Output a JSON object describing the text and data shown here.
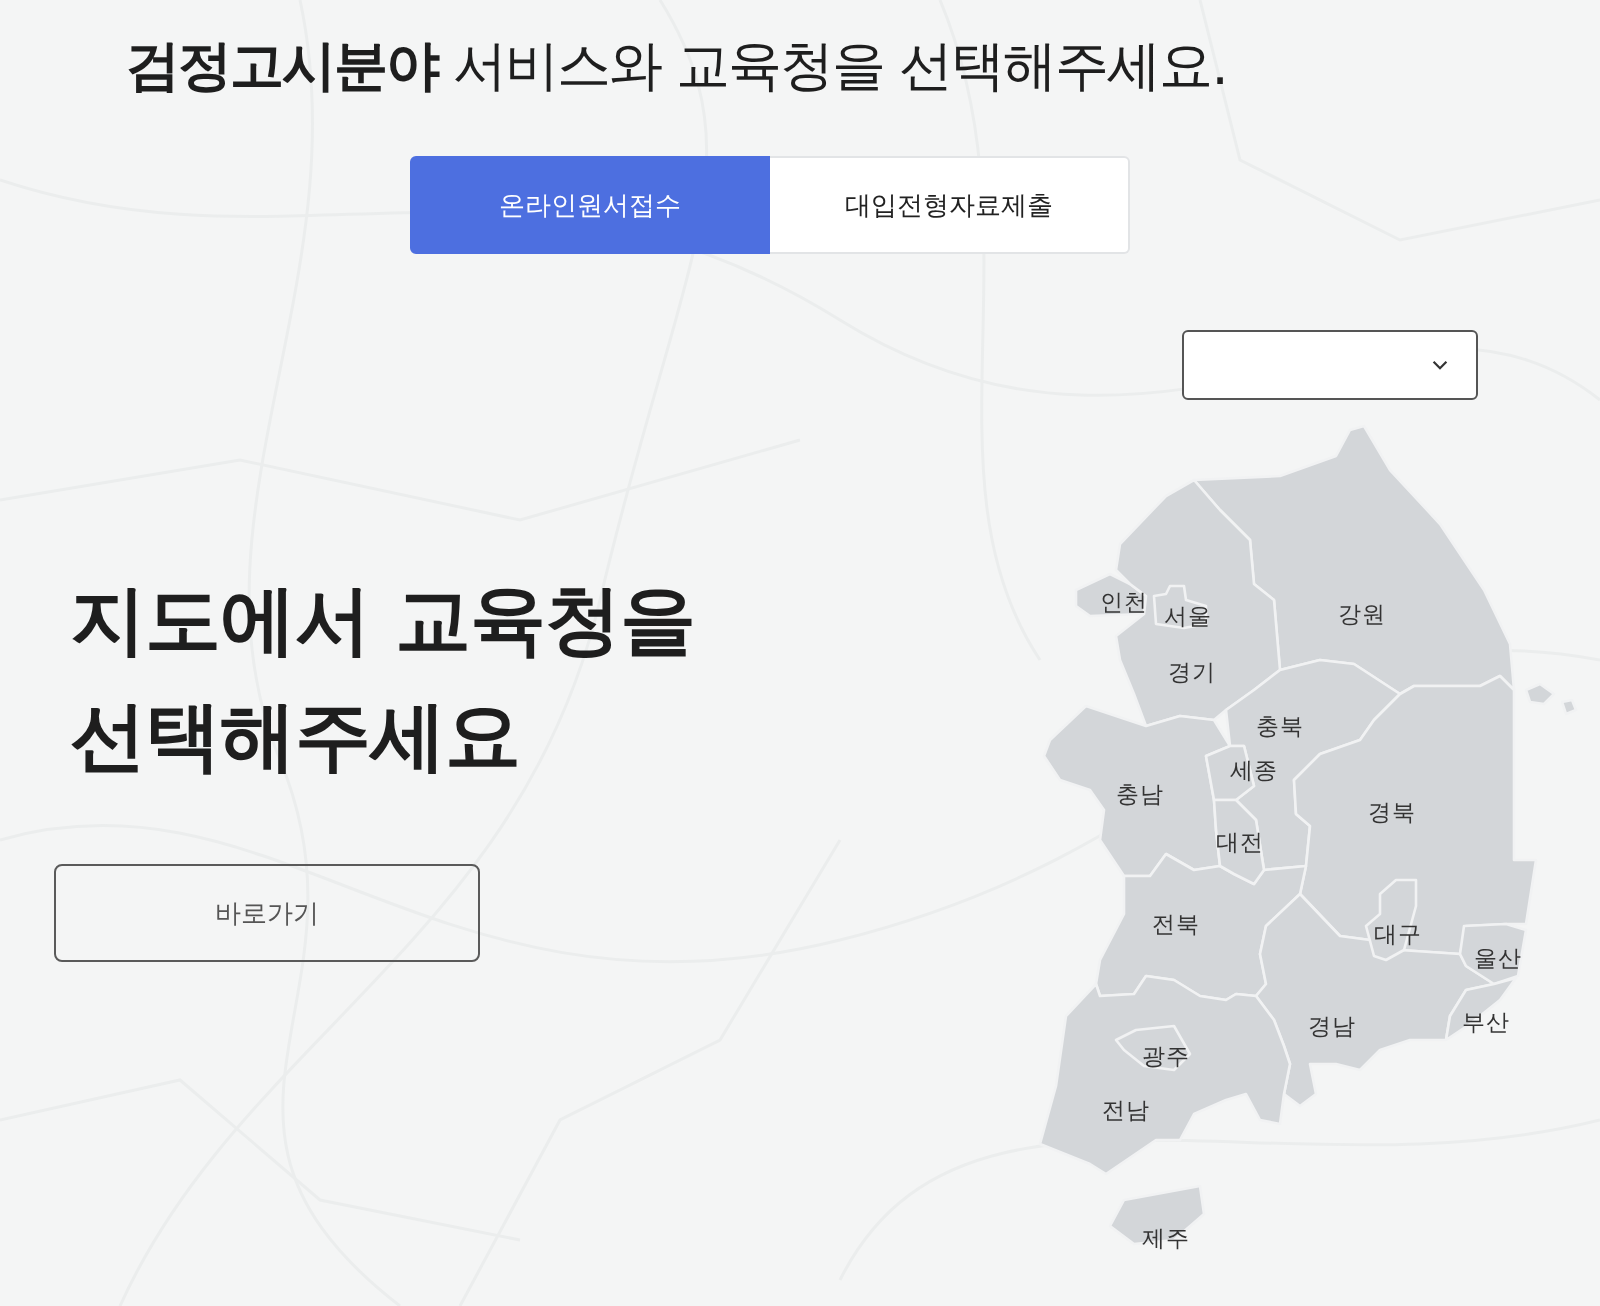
{
  "header": {
    "title": "**검정고시분야** 서비스와 교육청을 선택해주세요."
  },
  "tabs": [
    {
      "label": "온라인원서접수",
      "selected": true
    },
    {
      "label": "대입전형자료제출",
      "selected": false
    }
  ],
  "intro": {
    "heading": "지도에서 교육청을 선택해주세요",
    "button": "바로가기"
  },
  "map": {
    "regions": [
      "인천",
      "서울",
      "강원",
      "경기",
      "충북",
      "세종",
      "충남",
      "경북",
      "대전",
      "전북",
      "대구",
      "울산",
      "경남",
      "부산",
      "광주",
      "전남",
      "제주"
    ]
  }
}
